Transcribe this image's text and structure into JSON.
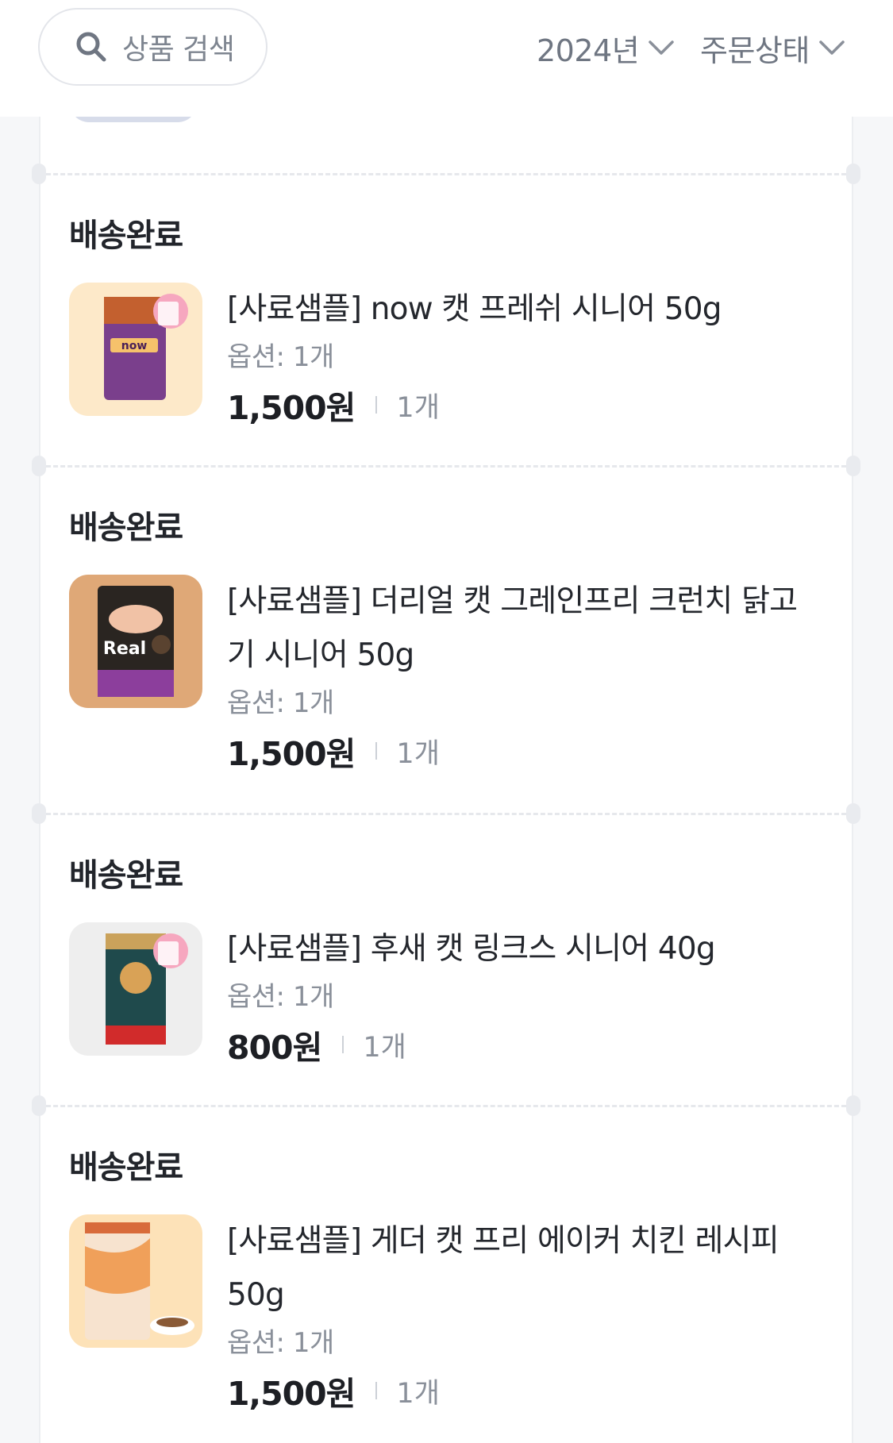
{
  "header": {
    "search_placeholder": "상품 검색",
    "search_icon": "search-icon",
    "year_filter": "2024년",
    "status_filter": "주문상태",
    "chevron_icon": "chevron-down-icon"
  },
  "orders": [
    {
      "status": "배송완료",
      "name": "[사료샘플] now 캣 프레쉬 시니어 50g",
      "option": "옵션: 1개",
      "price": "1,500원",
      "qty": "1개",
      "thumb_bg": "#fde9c9"
    },
    {
      "status": "배송완료",
      "name": "[사료샘플] 더리얼 캣 그레인프리 크런치 닭고기 시니어 50g",
      "option": "옵션: 1개",
      "price": "1,500원",
      "qty": "1개",
      "thumb_bg": "#dfa877"
    },
    {
      "status": "배송완료",
      "name": "[사료샘플] 후새 캣 링크스 시니어 40g",
      "option": "옵션: 1개",
      "price": "800원",
      "qty": "1개",
      "thumb_bg": "#eeeeee"
    },
    {
      "status": "배송완료",
      "name": "[사료샘플] 게더 캣 프리 에이커 치킨 레시피 50g",
      "option": "옵션: 1개",
      "price": "1,500원",
      "qty": "1개",
      "thumb_bg": "#fde2b8"
    }
  ],
  "colors": {
    "page_bg": "#f6f7f9",
    "card_bg": "#ffffff",
    "text_primary": "#1d1f24",
    "text_secondary": "#8a909a"
  }
}
